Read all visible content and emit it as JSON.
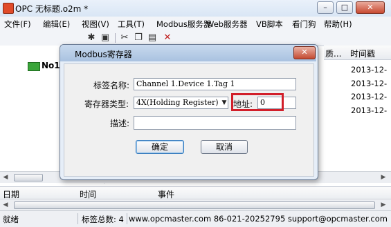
{
  "window": {
    "title": "OPC          无标题.o2m *",
    "controls": {
      "minimize": "–",
      "maximize": "□",
      "close": "✕"
    }
  },
  "menubar": {
    "items": [
      "文件(F)",
      "编辑(E)",
      "视图(V)",
      "工具(T)",
      "Modbus服务器",
      "Web服务器",
      "VB脚本",
      "看门狗",
      "帮助(H)"
    ]
  },
  "toolbar": {
    "icons": [
      "new-tag-icon",
      "properties-icon",
      "cut-icon",
      "copy-icon",
      "paste-icon",
      "delete-icon"
    ]
  },
  "tree": {
    "root_label": "No1"
  },
  "list": {
    "col_quality": "质...",
    "col_time": "时间戳",
    "rows": [
      "2013-12-",
      "2013-12-",
      "2013-12-",
      "2013-12-"
    ]
  },
  "dialog": {
    "title": "Modbus寄存器",
    "close": "✕",
    "tag_name_label": "标签名称:",
    "tag_name_value": "Channel 1.Device 1.Tag 1",
    "register_type_label": "寄存器类型:",
    "register_type_value": "4X(Holding Register)",
    "address_label": "地址:",
    "address_value": "0",
    "description_label": "描述:",
    "description_value": "",
    "ok_label": "确定",
    "cancel_label": "取消"
  },
  "log": {
    "col_date": "日期",
    "col_time": "时间",
    "col_event": "事件"
  },
  "statusbar": {
    "ready": "就绪",
    "tag_count": "标签总数: 4",
    "contact": "www.opcmaster.com 86-021-20252795 support@opcmaster.com"
  },
  "colors": {
    "highlight": "#d21f2a",
    "dialog_bg": "#f0f0f0",
    "titlebar": "#d9e6f5"
  }
}
